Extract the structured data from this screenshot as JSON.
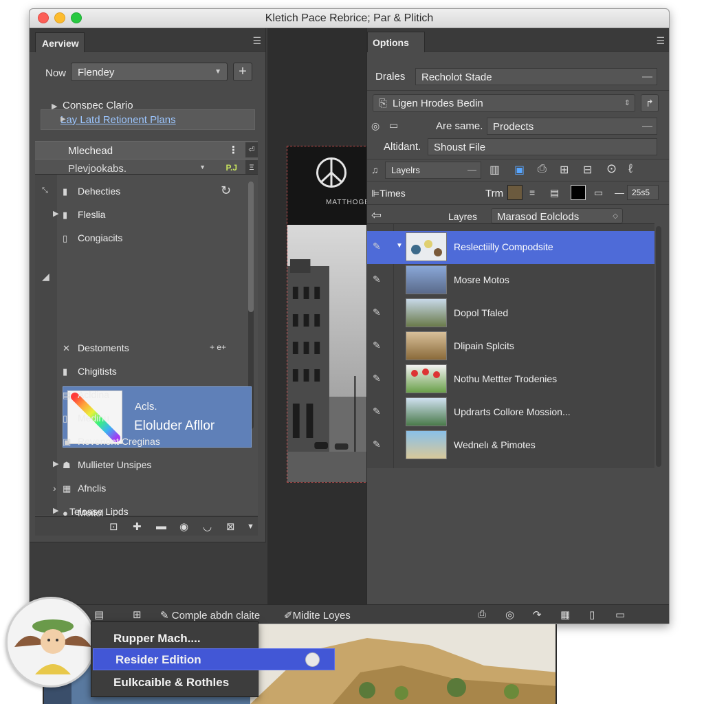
{
  "window": {
    "title": "Kletich Pace Rebrice; Par & Plitich"
  },
  "left_panel": {
    "tab": "Aerview",
    "now_label": "Now",
    "now_value": "Flendey",
    "tree": [
      {
        "label": "Conspec Clario"
      },
      {
        "label": "Lay Latd Retionent Plans"
      }
    ],
    "header_rows": [
      {
        "label": "Mlechead",
        "badge": ""
      },
      {
        "label": "Plevjookabs.",
        "badge": "P.J"
      }
    ],
    "items": [
      {
        "label": "Dehecties",
        "icon": "flask-icon"
      },
      {
        "label": "Fleslia",
        "icon": "bottle-icon"
      },
      {
        "label": "Congiacits",
        "icon": "bottle-icon"
      },
      {
        "label": "Destoments",
        "icon": "cross-tools-icon",
        "extra": "+ e+"
      },
      {
        "label": "Chigitists",
        "icon": "bottle-icon"
      },
      {
        "label": "Acldina",
        "icon": "document-icon"
      },
      {
        "label": "Medinu",
        "icon": "bottle-icon"
      },
      {
        "label": "Revenont Creginas",
        "icon": "image-icon"
      },
      {
        "label": "Mullieter Unsipes",
        "icon": "people-icon"
      },
      {
        "label": "Afnclis",
        "icon": "grid-icon"
      },
      {
        "label": "Teloase Lipds",
        "icon": ""
      },
      {
        "label": "Moitol",
        "icon": "circle-icon"
      }
    ],
    "selected": {
      "small": "Acls.",
      "big": "Eloluder Afllor"
    }
  },
  "canvas": {
    "logo_text": "MATTHOGE"
  },
  "options_panel": {
    "tab": "Options",
    "drales_label": "Drales",
    "drales_value": "Recholot Stade",
    "preset_value": "Ligen Hrodes Bedin",
    "are_same_label": "Are same.",
    "are_same_value": "Prodects",
    "altidant_label": "Altidant.",
    "altidant_value": "Shoust File",
    "layers_dropdown": "Layelrs",
    "times_label": "Times",
    "trm_label": "Trm",
    "zoom_value": "25s5",
    "layres_label": "Layres",
    "layres_value": "Marasod Eolclods",
    "layers": [
      {
        "name": "Reslectiilly Compodsite",
        "selected": true
      },
      {
        "name": "Mosre Motos",
        "selected": false
      },
      {
        "name": "Dopol Tfaled",
        "selected": false
      },
      {
        "name": "Dlipain Splcits",
        "selected": false
      },
      {
        "name": "Nothu Mettter Trodenies",
        "selected": false
      },
      {
        "name": "Updrarts Collore Mossion...",
        "selected": false
      },
      {
        "name": "Wednelı & Pimotes",
        "selected": false
      }
    ]
  },
  "bottom_bar": {
    "item1": "Comple abdn claite",
    "item2": "Midite Loyes"
  },
  "popup_menu": {
    "items": [
      "Rupper Mach....",
      "Resider Edition",
      "Eulkcaible & Rothles"
    ],
    "highlighted_index": 1
  }
}
